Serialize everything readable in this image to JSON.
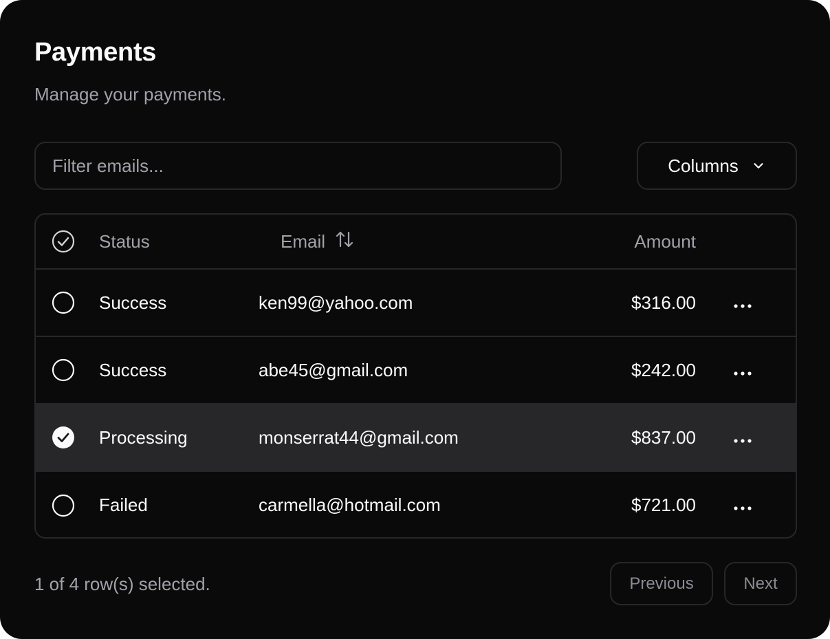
{
  "header": {
    "title": "Payments",
    "subtitle": "Manage your payments."
  },
  "toolbar": {
    "filter_placeholder": "Filter emails...",
    "filter_value": "",
    "columns_label": "Columns"
  },
  "table": {
    "columns": {
      "status": "Status",
      "email": "Email",
      "amount": "Amount"
    },
    "header_checkbox": "checked",
    "rows": [
      {
        "status": "Success",
        "email": "ken99@yahoo.com",
        "amount": "$316.00",
        "selected": false
      },
      {
        "status": "Success",
        "email": "abe45@gmail.com",
        "amount": "$242.00",
        "selected": false
      },
      {
        "status": "Processing",
        "email": "monserrat44@gmail.com",
        "amount": "$837.00",
        "selected": true
      },
      {
        "status": "Failed",
        "email": "carmella@hotmail.com",
        "amount": "$721.00",
        "selected": false
      }
    ]
  },
  "footer": {
    "selection_text": "1 of 4 row(s) selected.",
    "previous_label": "Previous",
    "next_label": "Next"
  },
  "icons": {
    "chevron": "chevron-down-icon",
    "sort": "arrow-up-down-icon",
    "more": "more-horizontal-icon",
    "check": "check-circle-icon",
    "circle": "circle-icon"
  },
  "colors": {
    "background": "#0a0a0b",
    "border": "#27272a",
    "muted_text": "#a1a1aa",
    "foreground": "#fafafa",
    "selected_row": "#27272a"
  }
}
